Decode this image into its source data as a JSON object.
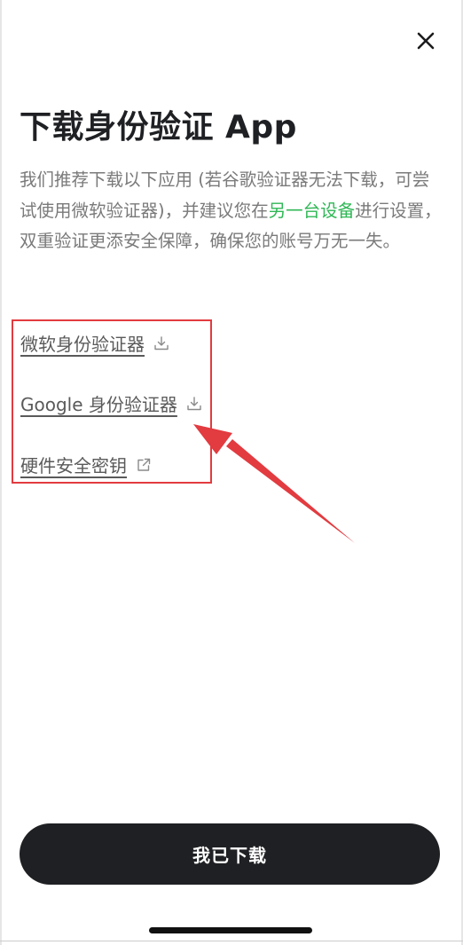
{
  "header": {
    "close_icon": "close-icon"
  },
  "main": {
    "title": "下载身份验证 App",
    "description": {
      "part1": "我们推荐下载以下应用 (若谷歌验证器无法下载，可尝试使用微软验证器)，并建议您在",
      "highlight": "另一台设备",
      "part2": "进行设置，双重验证更添安全保障，确保您的账号万无一失。"
    },
    "links": [
      {
        "label": "微软身份验证器",
        "icon": "download-icon"
      },
      {
        "label": "Google 身份验证器",
        "icon": "download-icon"
      },
      {
        "label": "硬件安全密钥",
        "icon": "external-link-icon"
      }
    ]
  },
  "footer": {
    "button_label": "我已下载"
  },
  "colors": {
    "accent_green": "#2fb755",
    "button_dark": "#1f2023",
    "annotation_red": "#e23b40"
  }
}
